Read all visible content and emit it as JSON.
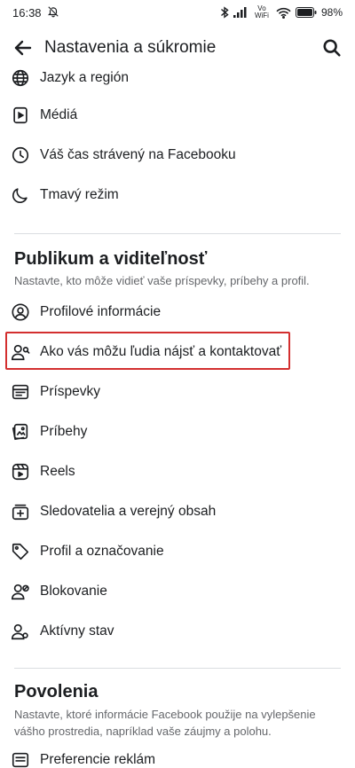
{
  "status_bar": {
    "time": "16:38",
    "network_label": "Vo WiFi",
    "battery": "98"
  },
  "header": {
    "title": "Nastavenia a súkromie"
  },
  "preferences_items": [
    {
      "label": "Jazyk a región",
      "icon": "globe-icon"
    },
    {
      "label": "Médiá",
      "icon": "media-icon"
    },
    {
      "label": "Váš čas strávený na Facebooku",
      "icon": "clock-icon"
    },
    {
      "label": "Tmavý režim",
      "icon": "moon-icon"
    }
  ],
  "audience_section": {
    "title": "Publikum a viditeľnosť",
    "description": "Nastavte, kto môže vidieť vaše príspevky, príbehy a profil.",
    "items": [
      {
        "label": "Profilové informácie",
        "icon": "profile-circle-icon"
      },
      {
        "label": "Ako vás môžu ľudia nájsť a kontaktovať",
        "icon": "find-people-icon",
        "highlighted": true
      },
      {
        "label": "Príspevky",
        "icon": "posts-icon"
      },
      {
        "label": "Príbehy",
        "icon": "stories-icon"
      },
      {
        "label": "Reels",
        "icon": "reels-icon"
      },
      {
        "label": "Sledovatelia a verejný obsah",
        "icon": "followers-icon"
      },
      {
        "label": "Profil a označovanie",
        "icon": "tag-icon"
      },
      {
        "label": "Blokovanie",
        "icon": "block-user-icon"
      },
      {
        "label": "Aktívny stav",
        "icon": "active-status-icon"
      }
    ]
  },
  "permissions_section": {
    "title": "Povolenia",
    "description": "Nastavte, ktoré informácie Facebook použije na vylepšenie vášho prostredia, napríklad vaše záujmy a polohu.",
    "items": [
      {
        "label": "Preferencie reklám",
        "icon": "ad-preferences-icon"
      }
    ]
  },
  "colors": {
    "highlight_border": "#d32f2f",
    "secondary_text": "#65676b",
    "divider": "#dadde1"
  }
}
